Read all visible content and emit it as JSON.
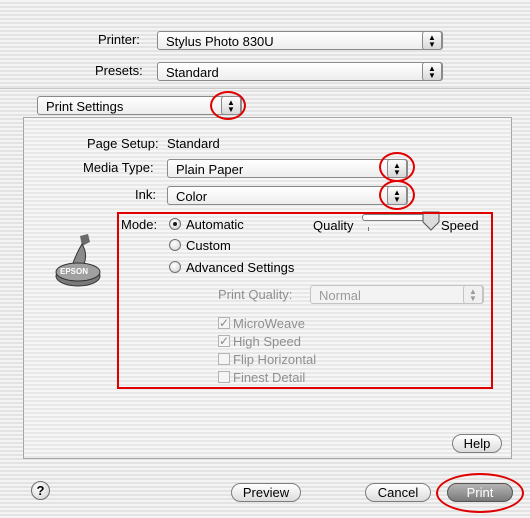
{
  "printer": {
    "label": "Printer:",
    "value": "Stylus Photo 830U"
  },
  "presets": {
    "label": "Presets:",
    "value": "Standard"
  },
  "section_menu": {
    "value": "Print Settings"
  },
  "page_setup": {
    "label": "Page Setup:",
    "value": "Standard"
  },
  "media_type": {
    "label": "Media Type:",
    "value": "Plain Paper"
  },
  "ink": {
    "label": "Ink:",
    "value": "Color"
  },
  "mode": {
    "label": "Mode:",
    "options": [
      {
        "label": "Automatic",
        "selected": true
      },
      {
        "label": "Custom",
        "selected": false
      },
      {
        "label": "Advanced Settings",
        "selected": false
      }
    ]
  },
  "quality_slider": {
    "left_label": "Quality",
    "right_label": "Speed",
    "value_fraction": 1.0
  },
  "logo": {
    "text": "EPSON"
  },
  "print_quality": {
    "label": "Print Quality:",
    "value": "Normal"
  },
  "checkboxes": [
    {
      "label": "MicroWeave",
      "checked": true
    },
    {
      "label": "High Speed",
      "checked": true
    },
    {
      "label": "Flip Horizontal",
      "checked": false
    },
    {
      "label": "Finest Detail",
      "checked": false
    }
  ],
  "buttons": {
    "help": "Help",
    "question": "?",
    "preview": "Preview",
    "cancel": "Cancel",
    "print": "Print"
  },
  "colors": {
    "highlight": "#e00000"
  }
}
